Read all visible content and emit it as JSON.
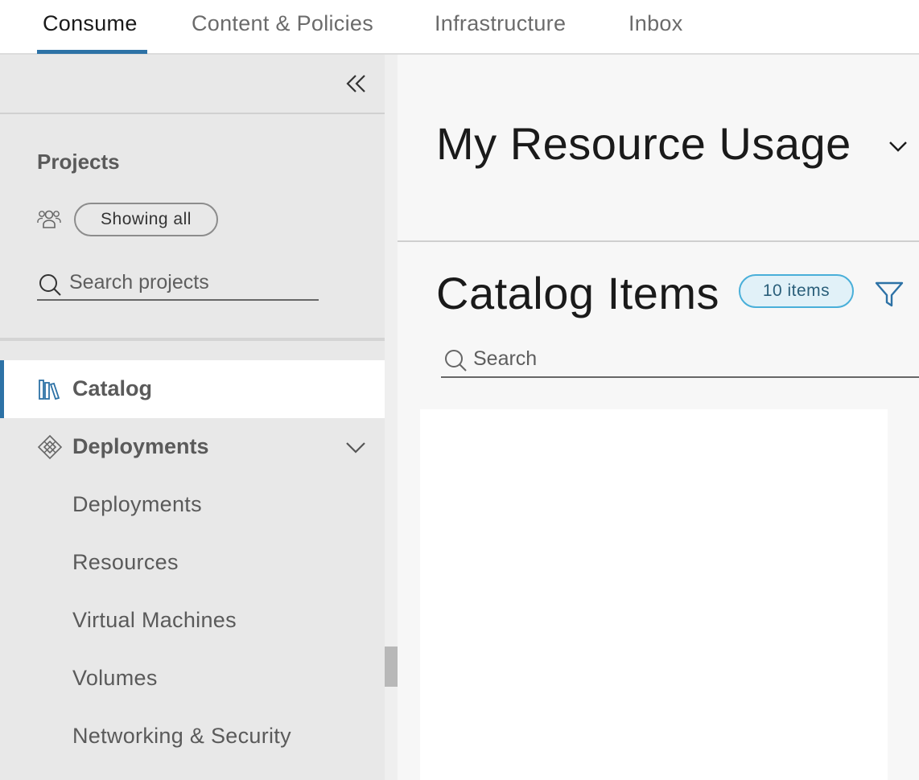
{
  "topnav": {
    "tabs": [
      {
        "label": "Consume",
        "active": true
      },
      {
        "label": "Content & Policies",
        "active": false
      },
      {
        "label": "Infrastructure",
        "active": false
      },
      {
        "label": "Inbox",
        "active": false
      }
    ]
  },
  "sidebar": {
    "collapse_icon": "double-chevron-left-icon",
    "projects_title": "Projects",
    "projects_filter_label": "Showing all",
    "projects_search_placeholder": "Search projects",
    "items": [
      {
        "label": "Catalog",
        "icon": "books-icon",
        "active": true
      },
      {
        "label": "Deployments",
        "icon": "network-diamond-icon",
        "expanded": true
      }
    ],
    "subitems": [
      "Deployments",
      "Resources",
      "Virtual Machines",
      "Volumes",
      "Networking & Security"
    ]
  },
  "main": {
    "resource_usage_title": "My Resource Usage",
    "catalog_title": "Catalog Items",
    "catalog_count_badge": "10 items",
    "catalog_search_placeholder": "Search"
  },
  "colors": {
    "accent": "#2d72a6",
    "badge_border": "#49afd9",
    "badge_bg": "#e1f1f8",
    "sidebar_bg": "#e8e8e8"
  }
}
